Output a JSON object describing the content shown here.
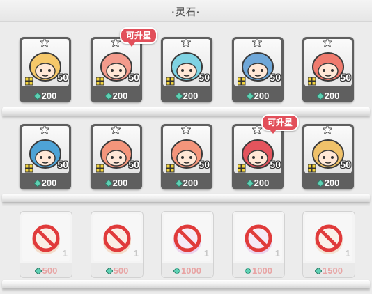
{
  "header": {
    "title": "·灵石·"
  },
  "rows": [
    {
      "items": [
        {
          "name": "winged-hero",
          "count": "50",
          "price": "200",
          "starred": true,
          "color": "#f6c86a"
        },
        {
          "name": "pink-girl",
          "count": "50",
          "price": "200",
          "starred": true,
          "color": "#f39b8c",
          "badge": "可升星"
        },
        {
          "name": "blue-chest",
          "count": "50",
          "price": "200",
          "starred": true,
          "color": "#7fd3e3"
        },
        {
          "name": "helmet-hero",
          "count": "50",
          "price": "200",
          "starred": true,
          "color": "#6fa7d8"
        },
        {
          "name": "red-beast",
          "count": "50",
          "price": "200",
          "starred": true,
          "color": "#ef7b6e"
        }
      ]
    },
    {
      "items": [
        {
          "name": "blue-dragon",
          "count": "50",
          "price": "200",
          "starred": true,
          "color": "#4ea3d6"
        },
        {
          "name": "octopus-1",
          "count": "50",
          "price": "200",
          "starred": true,
          "color": "#f4957b"
        },
        {
          "name": "octopus-2",
          "count": "50",
          "price": "200",
          "starred": true,
          "color": "#f4957b"
        },
        {
          "name": "coral-monster",
          "count": "50",
          "price": "200",
          "starred": true,
          "color": "#e4545d",
          "badge": "可升星"
        },
        {
          "name": "goggle-hero",
          "count": "50",
          "price": "200",
          "starred": true,
          "color": "#f0c26a"
        }
      ]
    },
    {
      "items": [
        {
          "name": "locked-1",
          "count": "1",
          "price": "500",
          "locked": true,
          "color": "#f2c9a8"
        },
        {
          "name": "locked-2",
          "count": "1",
          "price": "500",
          "locked": true,
          "color": "#f2c9a8"
        },
        {
          "name": "locked-3",
          "count": "1",
          "price": "1000",
          "locked": true,
          "color": "#e2b6e6"
        },
        {
          "name": "locked-4",
          "count": "1",
          "price": "1000",
          "locked": true,
          "color": "#e2b6e6"
        },
        {
          "name": "locked-5",
          "count": "1",
          "price": "1500",
          "locked": true,
          "color": "#f3d2b6"
        }
      ]
    }
  ],
  "colors": {
    "gem": "#5fd1b4",
    "badge": "#e24f5a",
    "ban": "#e03b3b"
  }
}
